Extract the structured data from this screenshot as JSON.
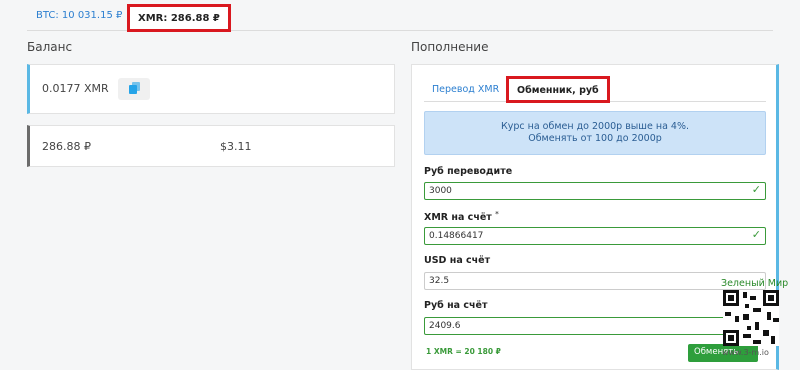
{
  "top_tabs": {
    "btc": "BTC: 10 031.15 ₽",
    "xmr": "XMR: 286.88 ₽"
  },
  "balance": {
    "title": "Баланс",
    "xmr_amount": "0.0177 XMR",
    "rub_amount": "286.88 ₽",
    "usd_amount": "$3.11"
  },
  "topup": {
    "title": "Пополнение",
    "tabs": [
      "Перевод XMR",
      "Обменник, руб"
    ],
    "info_line1": "Курс на обмен до 2000р выше на 4%.",
    "info_line2": "Обменять от 100 до 2000р",
    "fields": [
      {
        "label": "Руб переводите",
        "value": "3000",
        "valid": true
      },
      {
        "label": "XMR на счёт",
        "required_mark": "*",
        "value": "0.14866417",
        "valid": true
      },
      {
        "label": "USD на счёт",
        "value": "32.5",
        "valid": false
      },
      {
        "label": "Руб на счёт",
        "value": "2409.6",
        "valid": true
      }
    ],
    "rate": "1 XMR = 20 180 ₽",
    "submit": "Обменять"
  },
  "watermark": {
    "name": "Зеленый Мир",
    "url": "www.3-m.io"
  },
  "colors": {
    "accent_blue": "#5ab8e4",
    "highlight_red": "#d9181f",
    "success_green": "#2e9e3c"
  }
}
